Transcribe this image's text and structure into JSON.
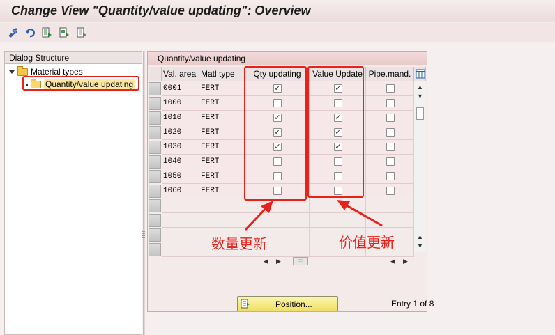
{
  "title": "Change View \"Quantity/value updating\": Overview",
  "toolbar": {
    "icons": [
      "change-display-icon",
      "undo-icon",
      "select-all-icon",
      "select-block-icon",
      "deselect-all-icon"
    ]
  },
  "dialog_structure": {
    "header": "Dialog Structure",
    "items": [
      {
        "label": "Material types",
        "icon": "folder-icon"
      },
      {
        "label": "Quantity/value updating",
        "icon": "open-folder-icon"
      }
    ]
  },
  "table": {
    "caption": "Quantity/value updating",
    "columns": [
      "Val. area",
      "Matl type",
      "Qty updating",
      "Value Update",
      "Pipe.mand."
    ],
    "rows": [
      {
        "val_area": "0001",
        "matl_type": "FERT",
        "qty": true,
        "value": true,
        "pipe": false
      },
      {
        "val_area": "1000",
        "matl_type": "FERT",
        "qty": false,
        "value": false,
        "pipe": false
      },
      {
        "val_area": "1010",
        "matl_type": "FERT",
        "qty": true,
        "value": true,
        "pipe": false
      },
      {
        "val_area": "1020",
        "matl_type": "FERT",
        "qty": true,
        "value": true,
        "pipe": false
      },
      {
        "val_area": "1030",
        "matl_type": "FERT",
        "qty": true,
        "value": true,
        "pipe": false
      },
      {
        "val_area": "1040",
        "matl_type": "FERT",
        "qty": false,
        "value": false,
        "pipe": false
      },
      {
        "val_area": "1050",
        "matl_type": "FERT",
        "qty": false,
        "value": false,
        "pipe": false
      },
      {
        "val_area": "1060",
        "matl_type": "FERT",
        "qty": false,
        "value": false,
        "pipe": false
      }
    ]
  },
  "annotations": {
    "qty_label": "数量更新",
    "value_label": "价值更新",
    "color": "#e8211b"
  },
  "footer": {
    "position_button": "Position...",
    "entry_text": "Entry 1 of 8"
  }
}
